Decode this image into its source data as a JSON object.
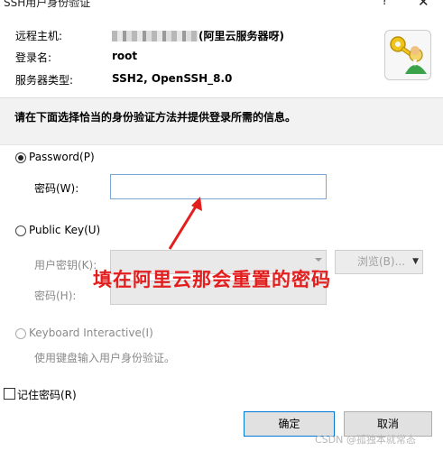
{
  "window": {
    "title": "SSH用户身份验证",
    "help": "?",
    "close": "✕"
  },
  "info": {
    "host_label": "远程主机:",
    "host_suffix": "(阿里云服务器呀)",
    "user_label": "登录名:",
    "user_value": "root",
    "type_label": "服务器类型:",
    "type_value": "SSH2, OpenSSH_8.0"
  },
  "instruction": "请在下面选择恰当的身份验证方法并提供登录所需的信息。",
  "password": {
    "radio_label": "Password(P)",
    "field_label": "密码(W):",
    "value": "",
    "selected": true
  },
  "public_key": {
    "radio_label": "Public Key(U)",
    "user_key_label": "用户密钥(K):",
    "browse_label": "浏览(B)...",
    "passphrase_label": "密码(H):",
    "selected": false
  },
  "keyboard": {
    "radio_label": "Keyboard Interactive(I)",
    "description": "使用键盘输入用户身份验证。",
    "selected": false
  },
  "remember": {
    "label": "记住密码(R)",
    "checked": false
  },
  "buttons": {
    "ok": "确定",
    "cancel": "取消"
  },
  "annotation": {
    "text": "填在阿里云那会重置的密码",
    "color": "#e31e1e"
  },
  "watermark": "CSDN @孤独本就常态",
  "icons": {
    "app": "key-user-icon",
    "arrow": "red-arrow"
  }
}
